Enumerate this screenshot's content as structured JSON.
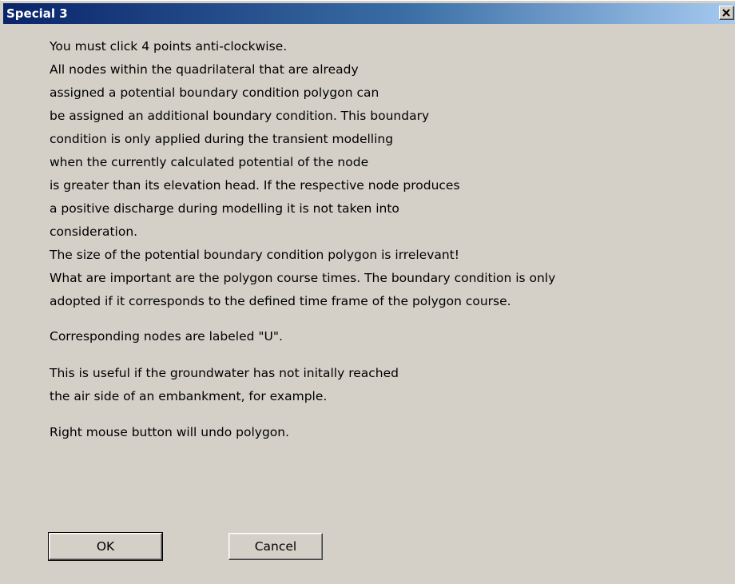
{
  "window": {
    "title": "Special 3"
  },
  "titlebar": {
    "close_icon": "close-x-icon"
  },
  "message": {
    "lines": [
      "You must click 4 points anti-clockwise.",
      "All nodes within the quadrilateral that are already",
      "assigned a potential boundary condition polygon can",
      "be assigned an additional boundary condition. This boundary",
      "condition is only applied during the transient modelling",
      "when the currently calculated potential of the node",
      "is greater than its elevation head. If the respective node produces",
      "a positive discharge during modelling it is not taken into",
      "consideration.",
      "The size of the potential boundary condition polygon is irrelevant!",
      "What are important are the polygon course times. The boundary condition is only",
      "adopted if it corresponds to the defined time frame of the polygon course.",
      "Corresponding nodes are labeled \"U\".",
      "This is useful if the groundwater has not initally reached",
      "the air side of an embankment, for example.",
      "Right mouse button will undo polygon."
    ]
  },
  "buttons": {
    "ok_label": "OK",
    "cancel_label": "Cancel"
  },
  "colors": {
    "dialog_face": "#d4d0c8",
    "title_gradient_start": "#0a246a",
    "title_gradient_end": "#a6caf0",
    "title_text": "#ffffff"
  }
}
